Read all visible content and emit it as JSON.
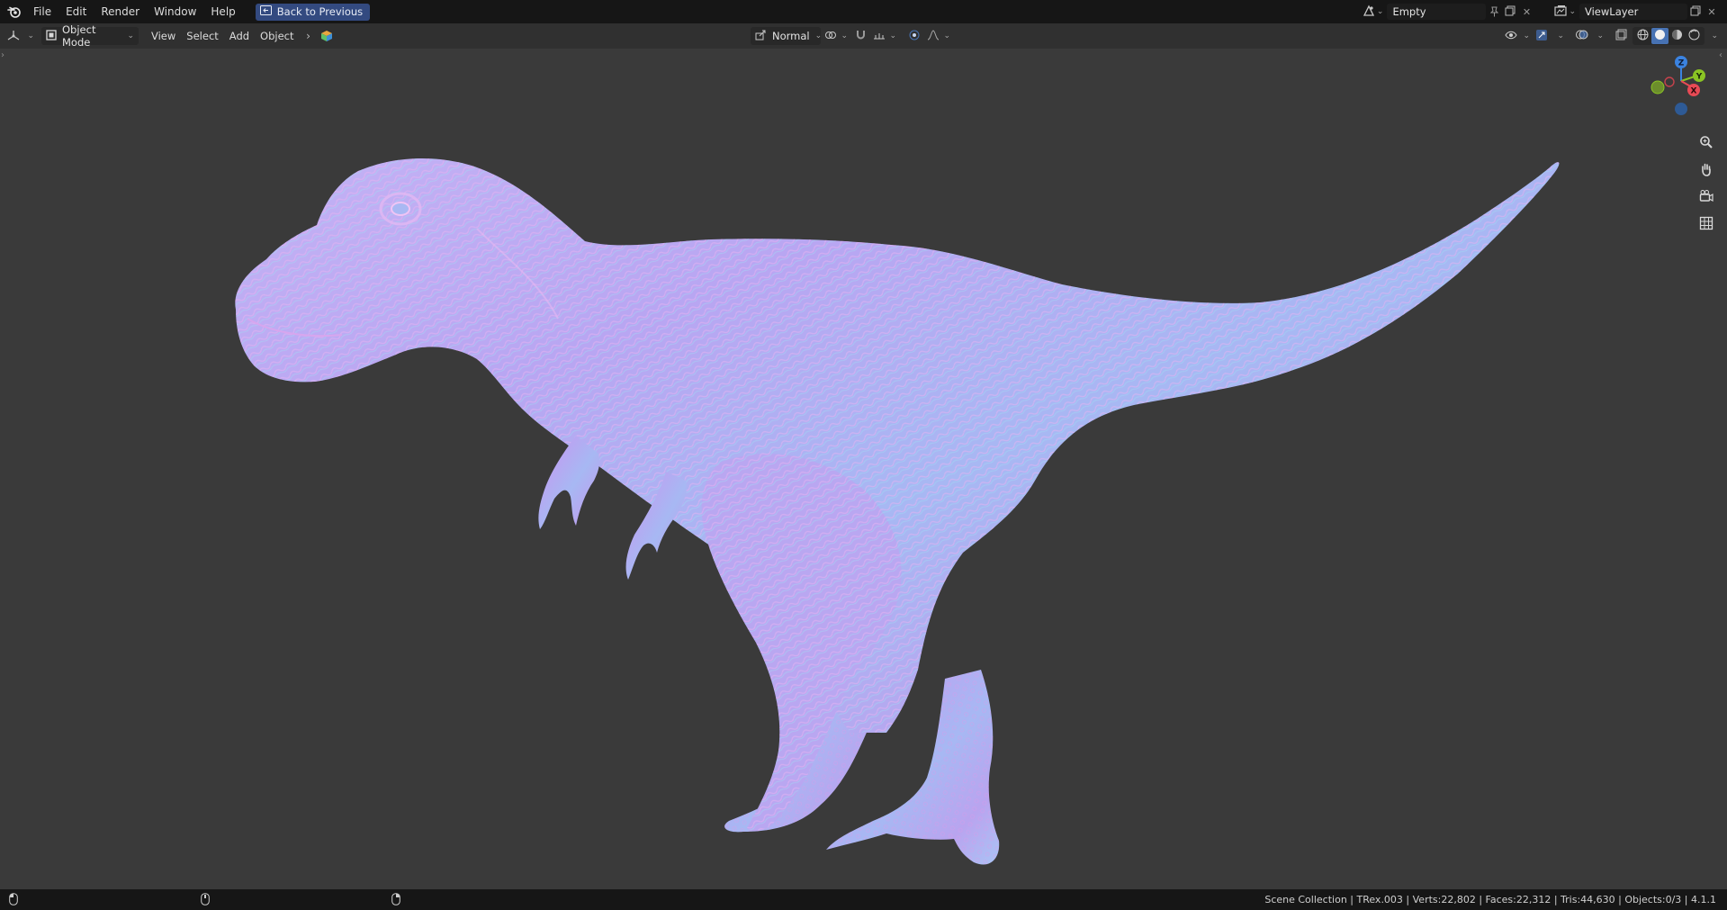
{
  "topbar": {
    "menus": [
      "File",
      "Edit",
      "Render",
      "Window",
      "Help"
    ],
    "back_label": "Back to Previous",
    "scene_name": "Empty",
    "view_layer": "ViewLayer"
  },
  "header": {
    "mode_label": "Object Mode",
    "menus": [
      "View",
      "Select",
      "Add",
      "Object"
    ],
    "orientation_label": "Normal"
  },
  "icons": {
    "app": "blender-logo-icon",
    "back": "back-arrow-icon",
    "editor_type": "viewport-editor-icon",
    "mode": "object-mode-icon",
    "scene": "scene-icon",
    "view_layer": "view-layer-icon",
    "pin": "pin-icon",
    "new": "duplicate-icon",
    "close": "close-icon",
    "gizmo": "axis-gizmo-icon",
    "zoom": "zoom-icon",
    "pan": "hand-icon",
    "camera": "camera-icon",
    "grid": "grid-icon"
  },
  "gizmo": {
    "z": "Z",
    "y": "Y",
    "x": "X"
  },
  "colors": {
    "accent": "#4772b3",
    "back_button": "#334a80",
    "axis_x": "#e84a55",
    "axis_y": "#8ac424",
    "axis_z": "#3b83e0",
    "viewport_bg": "#3a3a3a"
  },
  "statusbar": {
    "text": "Scene Collection | TRex.003 | Verts:22,802 | Faces:22,312 | Tris:44,630 | Objects:0/3 | 4.1.1"
  }
}
